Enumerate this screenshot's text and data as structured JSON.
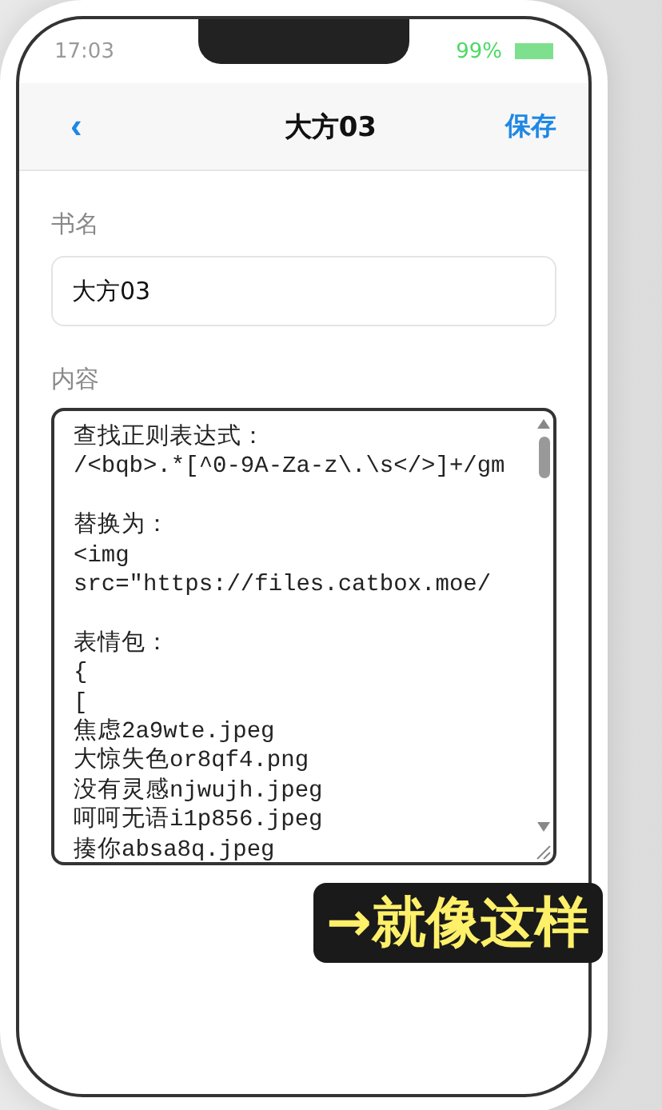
{
  "status_bar": {
    "time": "17:03",
    "battery_text": "99%"
  },
  "nav": {
    "back": "‹",
    "title": "大方03",
    "save": "保存"
  },
  "form": {
    "name_label": "书名",
    "name_value": "大方03",
    "content_label": "内容",
    "content_value": "查找正则表达式：\n/<bqb>.*[^0-9A-Za-z\\.\\s</>]+/gm\n\n替换为：\n<img\nsrc=\"https://files.catbox.moe/\n\n表情包：\n{\n[\n焦虑2a9wte.jpeg\n大惊失色or8qf4.png\n没有灵感njwujh.jpeg\n呵呵无语i1p856.jpeg\n揍你absa8q.jpeg"
  },
  "caption": "→就像这样"
}
